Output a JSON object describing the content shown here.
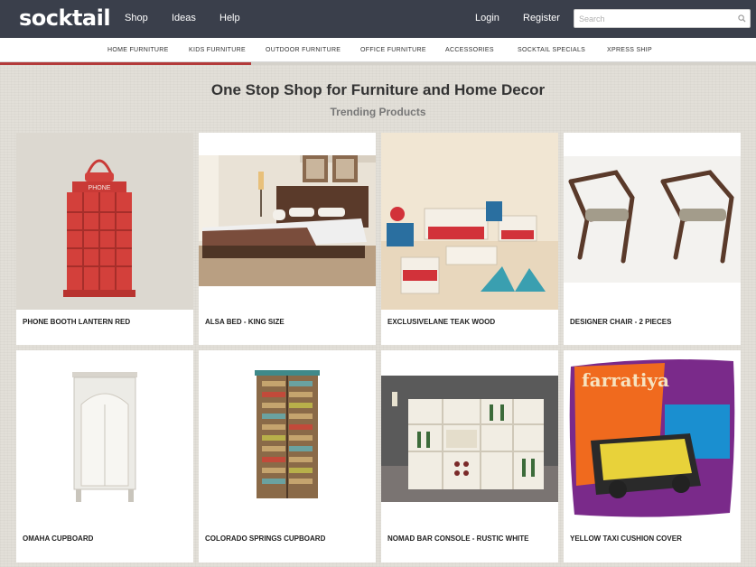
{
  "header": {
    "logo": "socktail",
    "nav": [
      "Shop",
      "Ideas",
      "Help"
    ],
    "login": "Login",
    "register": "Register",
    "search_placeholder": "Search"
  },
  "categories": [
    "HOME FURNITURE",
    "KIDS FURNITURE",
    "OUTDOOR FURNITURE",
    "OFFICE FURNITURE",
    "ACCESSORIES",
    "SOCKTAIL SPECIALS",
    "XPRESS SHIP"
  ],
  "main": {
    "headline": "One Stop Shop for Furniture and Home Decor",
    "subhead": "Trending Products"
  },
  "products": [
    {
      "name": "PHONE BOOTH LANTERN RED",
      "icon": "lantern-image"
    },
    {
      "name": "ALSA BED - KING SIZE",
      "icon": "bed-image"
    },
    {
      "name": "EXCLUSIVELANE TEAK WOOD",
      "icon": "sofa-set-image"
    },
    {
      "name": "DESIGNER CHAIR - 2 PIECES",
      "icon": "chairs-image"
    },
    {
      "name": "OMAHA CUPBOARD",
      "icon": "cupboard-image"
    },
    {
      "name": "COLORADO SPRINGS CUPBOARD",
      "icon": "cupboard-image"
    },
    {
      "name": "NOMAD BAR CONSOLE - RUSTIC WHITE",
      "icon": "bar-console-image"
    },
    {
      "name": "YELLOW TAXI CUSHION COVER",
      "icon": "cushion-image"
    }
  ],
  "colors": {
    "topbar": "#3a3f4b",
    "accent": "#b33a3a",
    "background": "#e2dfd8"
  }
}
